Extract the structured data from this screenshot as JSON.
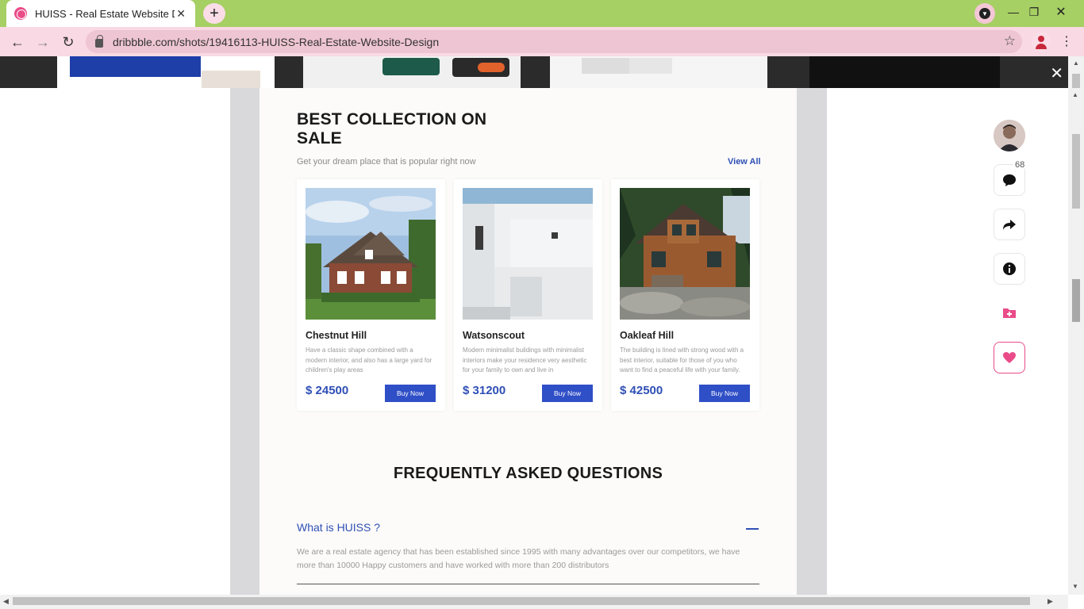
{
  "browser": {
    "tab_title": "HUISS - Real Estate Website Design",
    "tab_close": "✕",
    "new_tab": "+",
    "url": "dribbble.com/shots/19416113-HUISS-Real-Estate-Website-Design",
    "accent": "#a6cf64",
    "toolbar_color": "#f9d9e3"
  },
  "overlay": {
    "close": "✕"
  },
  "shot": {
    "heading": "BEST COLLECTION ON SALE",
    "subtitle": "Get your dream place that is popular right now",
    "view_all": "View All",
    "brand_color": "#2f4fb5",
    "listings": [
      {
        "name": "Chestnut Hill",
        "description": "Have a classic shape combined with a modern interior, and also has a large yard for children's play areas",
        "price": "$ 24500",
        "button": "Buy Now"
      },
      {
        "name": "Watsonscout",
        "description": "Modern minimalist buildings with minimalist interiors make your residence very aesthetic for your family to own and live in",
        "price": "$ 31200",
        "button": "Buy Now"
      },
      {
        "name": "Oakleaf Hill",
        "description": "The building is lined with strong wood with a best interior, suitable for those of you who want to find a peaceful life with your family.",
        "price": "$ 42500",
        "button": "Buy Now"
      }
    ],
    "faq": {
      "title": "FREQUENTLY ASKED QUESTIONS",
      "question": "What is HUISS ?",
      "answer": "We are a real estate agency that has been established since 1995 with many advantages over our competitors, we have more than 10000 Happy customers and have worked with more than 200 distributors"
    }
  },
  "actions": {
    "comments_count": "68",
    "icons": [
      "author-avatar",
      "comment-icon",
      "share-icon",
      "info-icon",
      "add-to-collection-icon",
      "like-icon"
    ]
  }
}
